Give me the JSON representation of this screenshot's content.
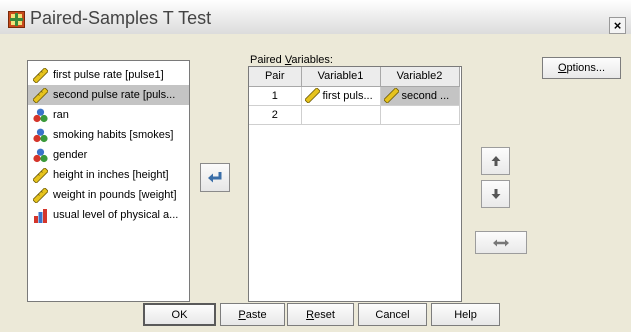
{
  "window": {
    "title": "Paired-Samples T Test",
    "close_label": "×"
  },
  "source_variables": [
    {
      "label": "first pulse rate [pulse1]",
      "icon": "ruler-icon",
      "selected": false
    },
    {
      "label": "second pulse rate [puls...",
      "icon": "ruler-icon",
      "selected": true
    },
    {
      "label": "ran",
      "icon": "nominal-icon",
      "selected": false
    },
    {
      "label": "smoking habits [smokes]",
      "icon": "nominal-icon",
      "selected": false
    },
    {
      "label": "gender",
      "icon": "nominal-icon",
      "selected": false
    },
    {
      "label": "height in inches [height]",
      "icon": "ruler-icon",
      "selected": false
    },
    {
      "label": "weight in pounds [weight]",
      "icon": "ruler-icon",
      "selected": false
    },
    {
      "label": "usual level of physical a...",
      "icon": "bar-chart-icon",
      "selected": false
    }
  ],
  "paired_variables": {
    "label_pre": "Paired ",
    "label_accel": "V",
    "label_post": "ariables:",
    "columns": [
      "Pair",
      "Variable1",
      "Variable2"
    ],
    "rows": [
      {
        "pair": "1",
        "var1": "first puls...",
        "var2": "second ..."
      },
      {
        "pair": "2",
        "var1": "",
        "var2": ""
      }
    ]
  },
  "buttons": {
    "options_accel": "O",
    "options_rest": "ptions...",
    "ok": "OK",
    "paste_accel": "P",
    "paste_rest": "aste",
    "reset_accel": "R",
    "reset_rest": "eset",
    "cancel": "Cancel",
    "help": "Help"
  },
  "colors": {
    "dialog_bg": "#ece9d8",
    "selection": "#c4c4c4",
    "arrow_blue": "#3a6ea8"
  }
}
